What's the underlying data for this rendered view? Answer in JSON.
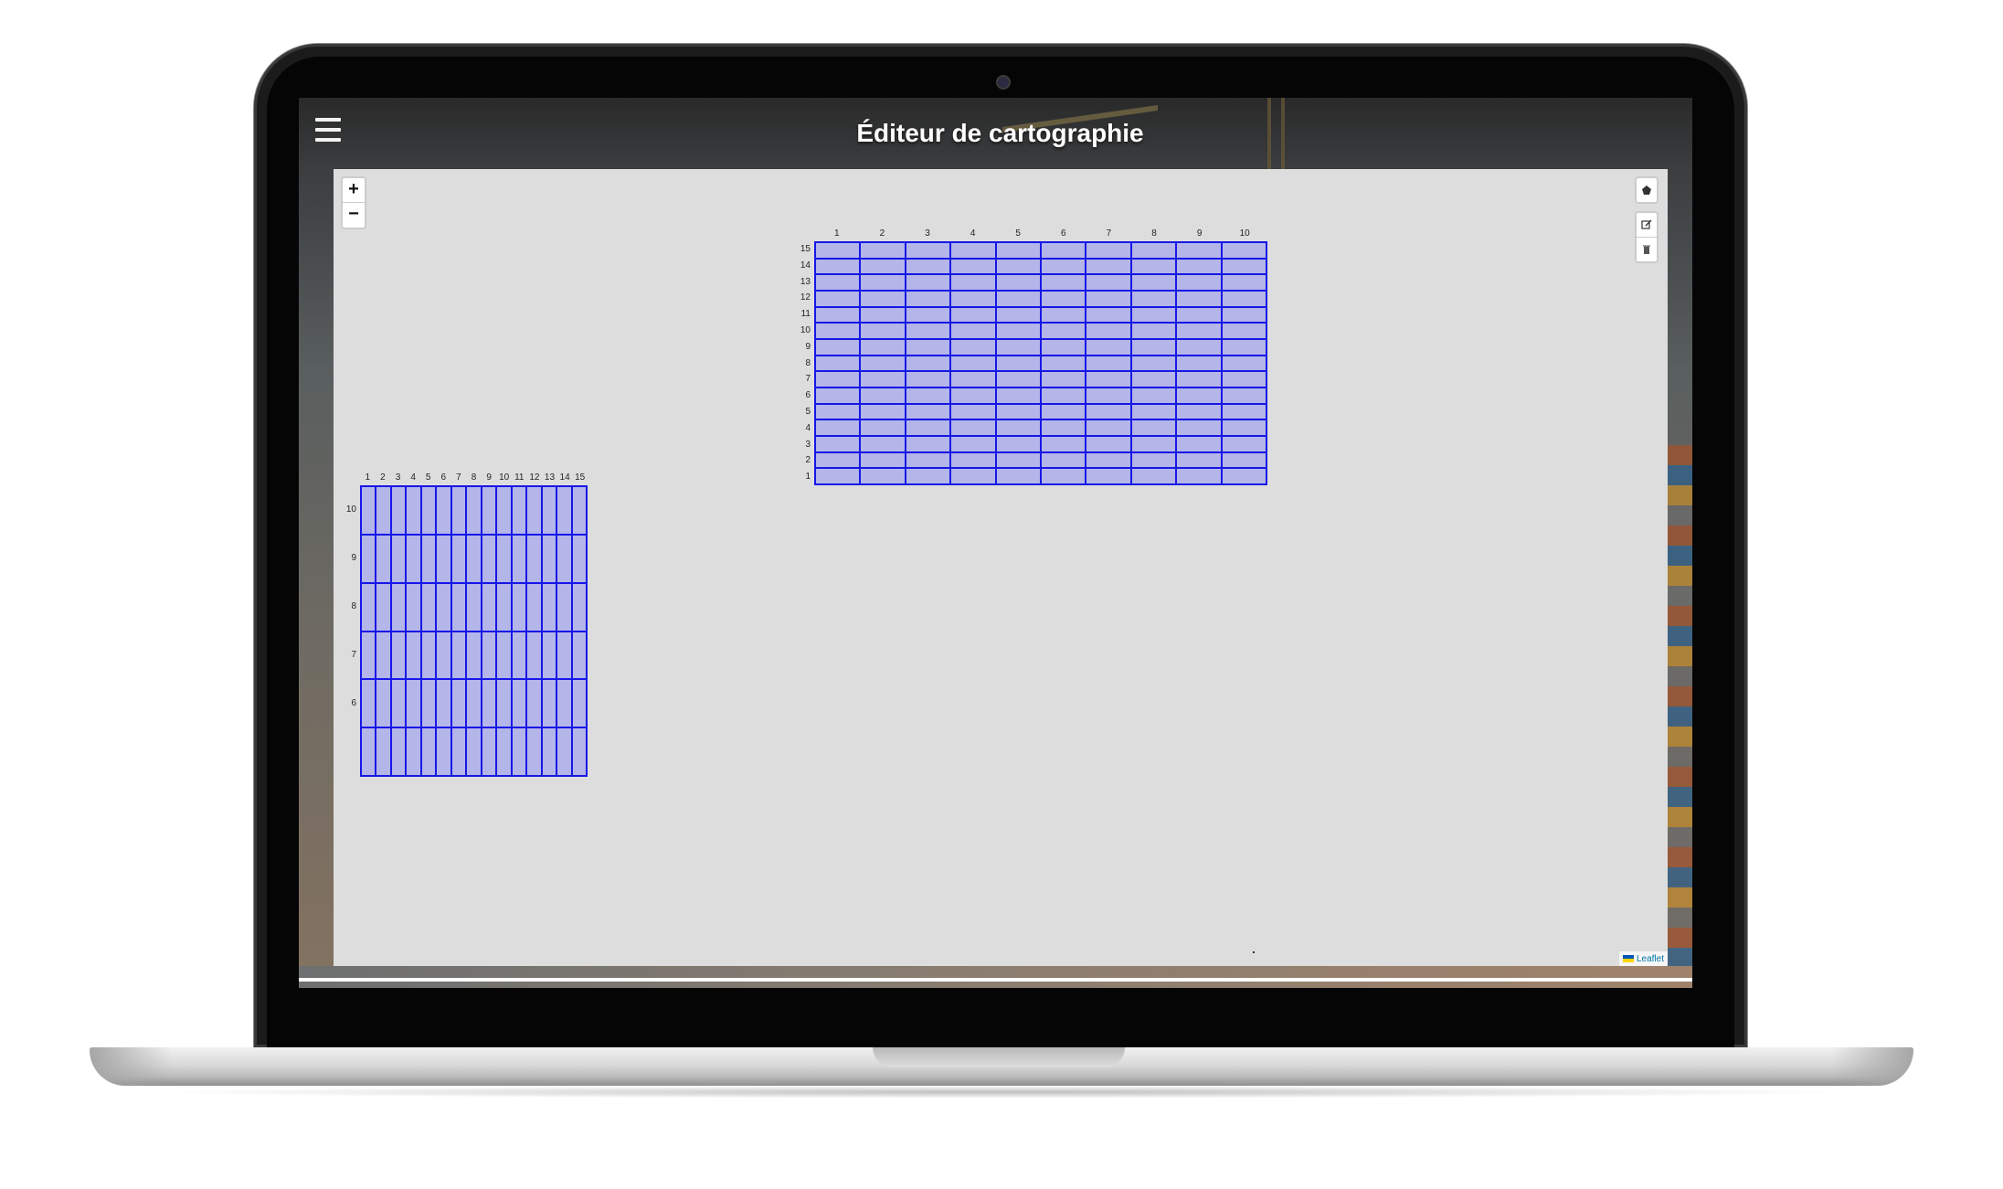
{
  "app": {
    "title": "Éditeur de cartographie",
    "menu_icon": "hamburger-menu-icon"
  },
  "map": {
    "background_color": "#dddddd",
    "zoom_in_label": "+",
    "zoom_out_label": "−",
    "toolbar": {
      "draw_polygon_icon": "polygon-icon",
      "edit_icon": "edit-layers-icon",
      "delete_icon": "trash-icon"
    },
    "attribution": "Leaflet"
  },
  "grids": [
    {
      "name": "grid-a",
      "cell_fill": "#b4b5e8",
      "stroke": "#1717e8",
      "columns": [
        "1",
        "2",
        "3",
        "4",
        "5",
        "6",
        "7",
        "8",
        "9",
        "10"
      ],
      "rows": [
        "15",
        "14",
        "13",
        "12",
        "11",
        "10",
        "9",
        "8",
        "7",
        "6",
        "5",
        "4",
        "3",
        "2",
        "1"
      ]
    },
    {
      "name": "grid-b",
      "cell_fill": "#b4b5e8",
      "stroke": "#1717e8",
      "columns": [
        "1",
        "2",
        "3",
        "4",
        "5",
        "6",
        "7",
        "8",
        "9",
        "10",
        "11",
        "12",
        "13",
        "14",
        "15"
      ],
      "rows": [
        "10",
        "9",
        "8",
        "7",
        "6"
      ],
      "partial_last_row": true
    }
  ]
}
